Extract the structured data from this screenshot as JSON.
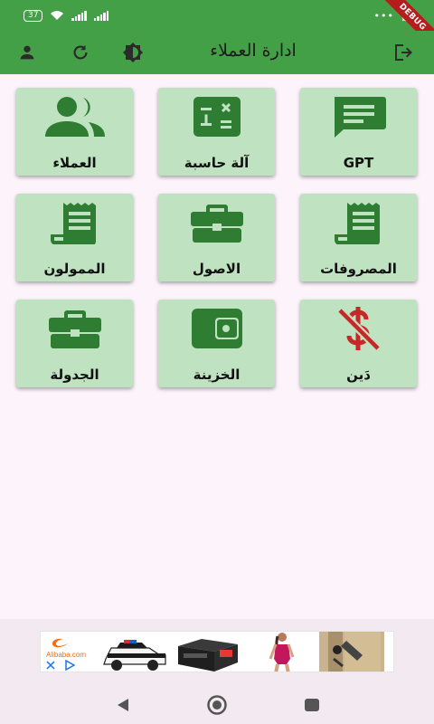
{
  "status_bar": {
    "battery": "37",
    "debug_label": "DEBUG"
  },
  "app_bar": {
    "title": "ادارة العملاء",
    "icons": [
      "person-icon",
      "refresh-icon",
      "theme-icon",
      "logout-icon"
    ]
  },
  "tiles": [
    {
      "label": "GPT",
      "icon": "chat-icon"
    },
    {
      "label": "آلة حاسبة",
      "icon": "calculator-icon"
    },
    {
      "label": "العملاء",
      "icon": "people-icon"
    },
    {
      "label": "المصروفات",
      "icon": "receipt-icon"
    },
    {
      "label": "الاصول",
      "icon": "briefcase-icon"
    },
    {
      "label": "الممولون",
      "icon": "receipt-icon"
    },
    {
      "label": "دَين",
      "icon": "money-off-icon"
    },
    {
      "label": "الخزينة",
      "icon": "wallet-icon"
    },
    {
      "label": "الجدولة",
      "icon": "briefcase-icon"
    }
  ],
  "ad": {
    "brand": "Alibaba.com"
  },
  "colors": {
    "primary": "#43a047",
    "icon": "#2e7d32",
    "tile_bg": "#bfe2c1",
    "danger": "#c62828"
  }
}
